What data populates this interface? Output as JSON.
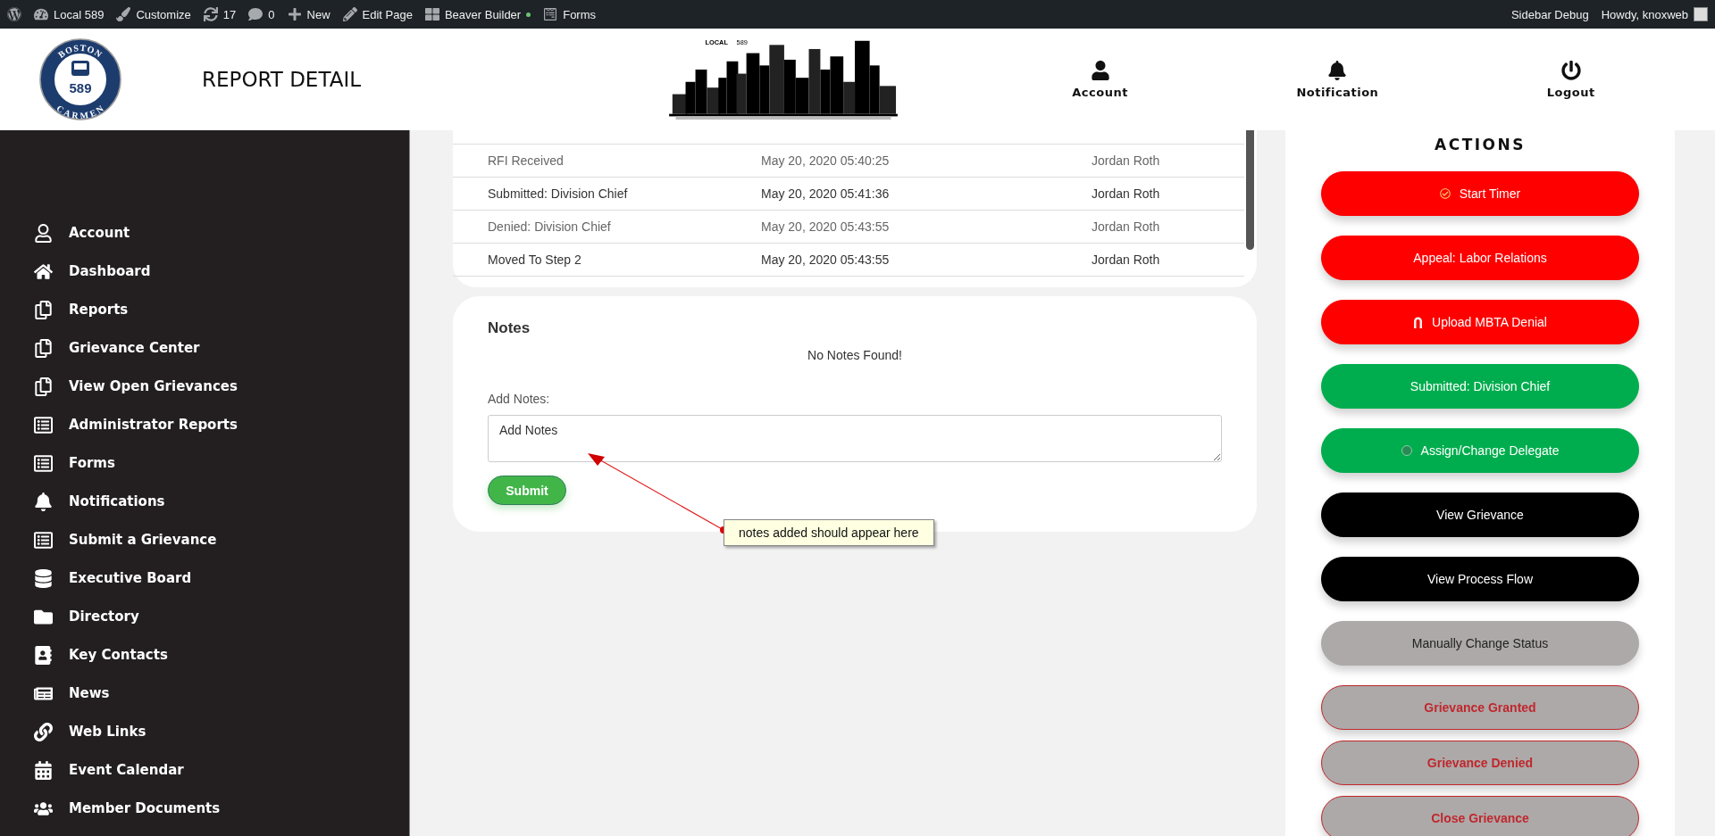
{
  "admin_bar": {
    "left": [
      {
        "kind": "wordpress"
      },
      {
        "kind": "dashboard",
        "label": "Local 589"
      },
      {
        "kind": "brush",
        "label": "Customize"
      },
      {
        "kind": "updates",
        "label": "17"
      },
      {
        "kind": "comments",
        "label": "0"
      },
      {
        "kind": "plus",
        "label": "New"
      },
      {
        "kind": "pencil",
        "label": "Edit Page"
      },
      {
        "kind": "builder",
        "label": "Beaver Builder"
      },
      {
        "kind": "forms",
        "label": "Forms"
      }
    ],
    "right": [
      {
        "label": "Sidebar Debug"
      },
      {
        "label": "Howdy, knoxweb"
      }
    ]
  },
  "header": {
    "logo": {
      "top": "BOSTON",
      "number": "589",
      "bottom": "CARMEN"
    },
    "title": "REPORT DETAIL",
    "skyline": {
      "label": "LOCAL",
      "number": "589"
    },
    "nav": [
      {
        "kind": "user",
        "label": "Account"
      },
      {
        "kind": "bell",
        "label": "Notification"
      },
      {
        "kind": "power",
        "label": "Logout"
      }
    ]
  },
  "sidebar": {
    "items": [
      {
        "kind": "user",
        "label": "Account"
      },
      {
        "kind": "home",
        "label": "Dashboard"
      },
      {
        "kind": "copy",
        "label": "Reports"
      },
      {
        "kind": "copy",
        "label": "Grievance Center"
      },
      {
        "kind": "copy",
        "label": "View Open Grievances"
      },
      {
        "kind": "form",
        "label": "Administrator Reports"
      },
      {
        "kind": "form",
        "label": "Forms"
      },
      {
        "kind": "bell",
        "label": "Notifications"
      },
      {
        "kind": "form",
        "label": "Submit a Grievance"
      },
      {
        "kind": "database",
        "label": "Executive Board"
      },
      {
        "kind": "folder",
        "label": "Directory"
      },
      {
        "kind": "contact",
        "label": "Key Contacts"
      },
      {
        "kind": "news",
        "label": "News"
      },
      {
        "kind": "link",
        "label": "Web Links"
      },
      {
        "kind": "calendar",
        "label": "Event Calendar"
      },
      {
        "kind": "people",
        "label": "Member Documents"
      }
    ]
  },
  "history": {
    "rows": [
      {
        "cells": [
          "RFI Received",
          "May 20, 2020 05:40:25",
          "Jordan Roth"
        ]
      },
      {
        "cells": [
          "Submitted: Division Chief",
          "May 20, 2020 05:41:36",
          "Jordan Roth"
        ]
      },
      {
        "cells": [
          "Denied: Division Chief",
          "May 20, 2020 05:43:55",
          "Jordan Roth"
        ]
      },
      {
        "cells": [
          "Moved To Step 2",
          "May 20, 2020 05:43:55",
          "Jordan Roth"
        ]
      }
    ]
  },
  "notes": {
    "title": "Notes",
    "empty": "No Notes Found!",
    "label": "Add Notes:",
    "placeholder": "Add Notes",
    "submit": "Submit"
  },
  "annotation": {
    "text": "notes added should appear here"
  },
  "actions": {
    "title": "ACTIONS",
    "buttons": [
      {
        "kind": "red",
        "label": "Start Timer"
      },
      {
        "kind": "red",
        "label": "Appeal: Labor Relations"
      },
      {
        "kind": "red",
        "label": "Upload MBTA Denial"
      },
      {
        "kind": "green",
        "label": "Submitted: Division Chief"
      },
      {
        "kind": "green",
        "label": "Assign/Change Delegate"
      },
      {
        "kind": "black",
        "label": "View Grievance"
      },
      {
        "kind": "black",
        "label": "View Process Flow"
      },
      {
        "kind": "gray",
        "label": "Manually Change Status"
      },
      {
        "kind": "outline",
        "label": "Grievance Granted"
      },
      {
        "kind": "outline",
        "label": "Grievance Denied"
      },
      {
        "kind": "outline",
        "label": "Close Grievance"
      }
    ]
  }
}
